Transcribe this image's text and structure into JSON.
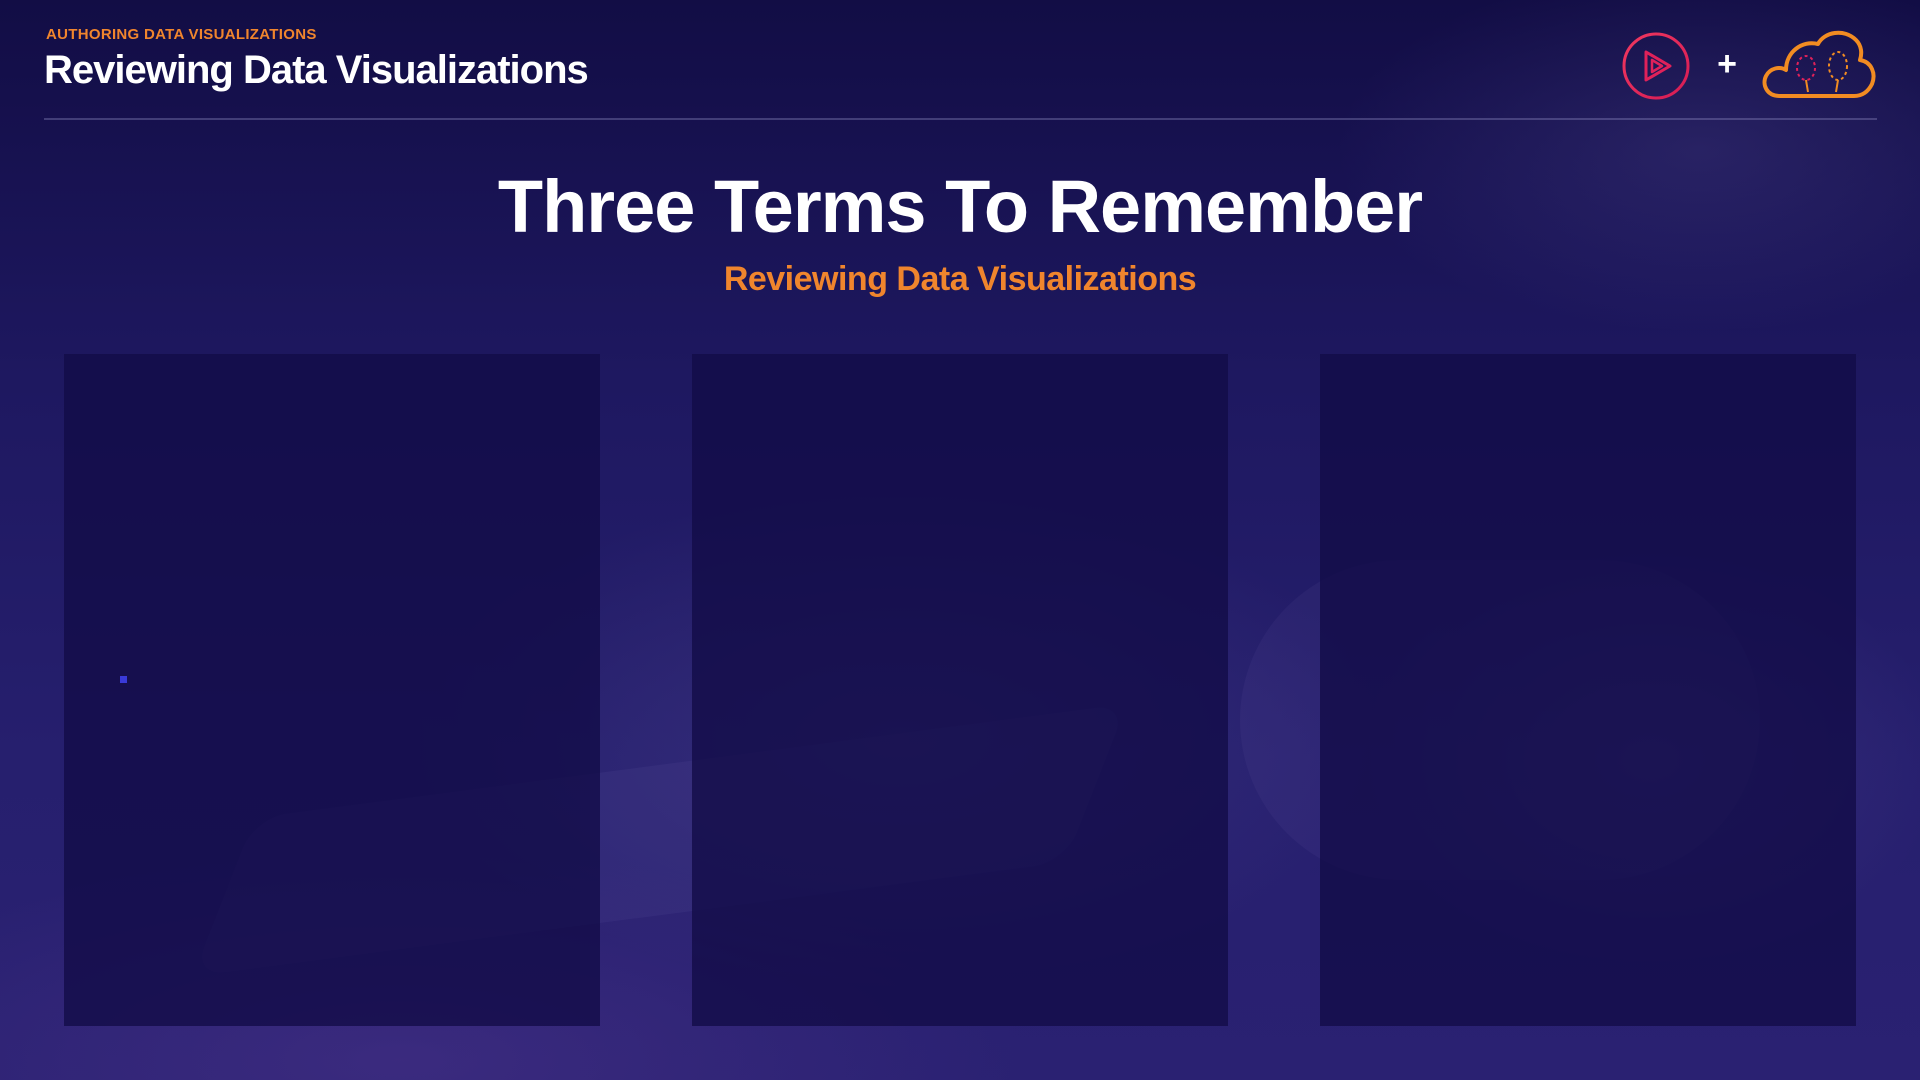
{
  "header": {
    "eyebrow": "AUTHORING DATA VISUALIZATIONS",
    "title": "Reviewing Data Visualizations"
  },
  "logos": {
    "plus": "+",
    "play_icon": "play-triangle-icon",
    "cloud_icon": "cloud-balloons-icon"
  },
  "main": {
    "title": "Three Terms To Remember",
    "subtitle": "Reviewing Data Visualizations"
  },
  "colors": {
    "accent": "#f0852d",
    "play_logo": "#e0215a",
    "cloud_logo": "#f28c22"
  }
}
